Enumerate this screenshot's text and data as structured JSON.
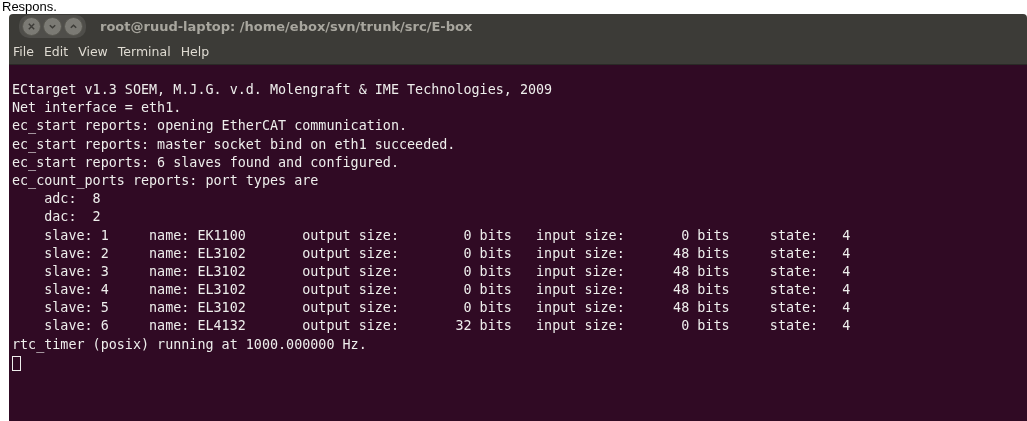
{
  "caption": "Respons.",
  "window": {
    "title": "root@ruud-laptop: /home/ebox/svn/trunk/src/E-box"
  },
  "menu": [
    "File",
    "Edit",
    "View",
    "Terminal",
    "Help"
  ],
  "terminal": {
    "lines": [
      "ECtarget v1.3 SOEM, M.J.G. v.d. Molengraft & IME Technologies, 2009",
      "Net interface = eth1.",
      "ec_start reports: opening EtherCAT communication.",
      "ec_start reports: master socket bind on eth1 succeeded.",
      "ec_start reports: 6 slaves found and configured.",
      "ec_count_ports reports: port types are",
      "    adc:  8",
      "    dac:  2",
      "    slave: 1     name: EK1100       output size:        0 bits   input size:       0 bits     state:   4",
      "    slave: 2     name: EL3102       output size:        0 bits   input size:      48 bits     state:   4",
      "    slave: 3     name: EL3102       output size:        0 bits   input size:      48 bits     state:   4",
      "    slave: 4     name: EL3102       output size:        0 bits   input size:      48 bits     state:   4",
      "    slave: 5     name: EL3102       output size:        0 bits   input size:      48 bits     state:   4",
      "    slave: 6     name: EL4132       output size:       32 bits   input size:       0 bits     state:   4",
      "rtc_timer (posix) running at 1000.000000 Hz."
    ]
  }
}
